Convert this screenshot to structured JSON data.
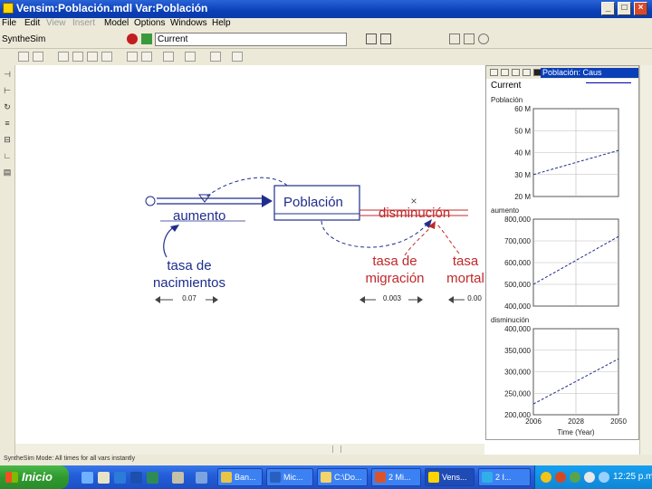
{
  "window": {
    "title": "Vensim:Población.mdl Var:Población",
    "minimize": "_",
    "maximize": "□",
    "close": "×"
  },
  "menu": [
    "File",
    "Edit",
    "View",
    "Insert",
    "Model",
    "Options",
    "Windows",
    "Help"
  ],
  "toolbar": {
    "sim_name": "SyntheSim",
    "run_name": "Current"
  },
  "model": {
    "stock": "Población",
    "inflow": "aumento",
    "outflow": "disminución",
    "aux1_line1": "tasa de",
    "aux1_line2": "nacimientos",
    "aux2_line1": "tasa de",
    "aux2_line2": "migración",
    "aux3_line1": "tasa",
    "aux3_line2": "mortal",
    "slider1_value": "0.07",
    "slider2_value": "0.003",
    "slider3_value": "0.00"
  },
  "graph_window": {
    "title": "Población: Caus",
    "run": "Current"
  },
  "chart_data": [
    {
      "type": "line",
      "title": "Población",
      "y_ticks": [
        "60 M",
        "50 M",
        "40 M",
        "30 M",
        "20 M"
      ],
      "ylim": [
        20000000,
        60000000
      ],
      "xlim": [
        2006,
        2050
      ],
      "x": [
        2006,
        2050
      ],
      "series": [
        {
          "values": [
            30000000,
            41000000
          ]
        }
      ]
    },
    {
      "type": "line",
      "title": "aumento",
      "y_ticks": [
        "800,000",
        "700,000",
        "600,000",
        "500,000",
        "400,000"
      ],
      "ylim": [
        400000,
        800000
      ],
      "xlim": [
        2006,
        2050
      ],
      "x": [
        2006,
        2050
      ],
      "series": [
        {
          "values": [
            500000,
            720000
          ]
        }
      ]
    },
    {
      "type": "line",
      "title": "disminución",
      "y_ticks": [
        "400,000",
        "350,000",
        "300,000",
        "250,000",
        "200,000"
      ],
      "ylim": [
        200000,
        400000
      ],
      "xlim": [
        2006,
        2050
      ],
      "x": [
        2006,
        2050
      ],
      "series": [
        {
          "values": [
            225000,
            330000
          ]
        }
      ],
      "x_ticks": [
        "2006",
        "2028",
        "2050"
      ],
      "xlabel": "Time (Year)"
    }
  ],
  "status_bar": "SyntheSim Mode: All times for all vars instantly",
  "taskbar": {
    "start": "Inicio",
    "tasks": [
      "Ban...",
      "Mic...",
      "C:\\Do...",
      "2 Mi...",
      "Vens...",
      "2 I..."
    ],
    "clock": "12:25 p.m."
  },
  "colors": {
    "stock_text": "#1f2d8c",
    "outflow_text": "#c0282b",
    "flow_arrow": "#1f2d8c",
    "curve_blue": "#1f2d8c",
    "curve_red": "#c0282b"
  }
}
